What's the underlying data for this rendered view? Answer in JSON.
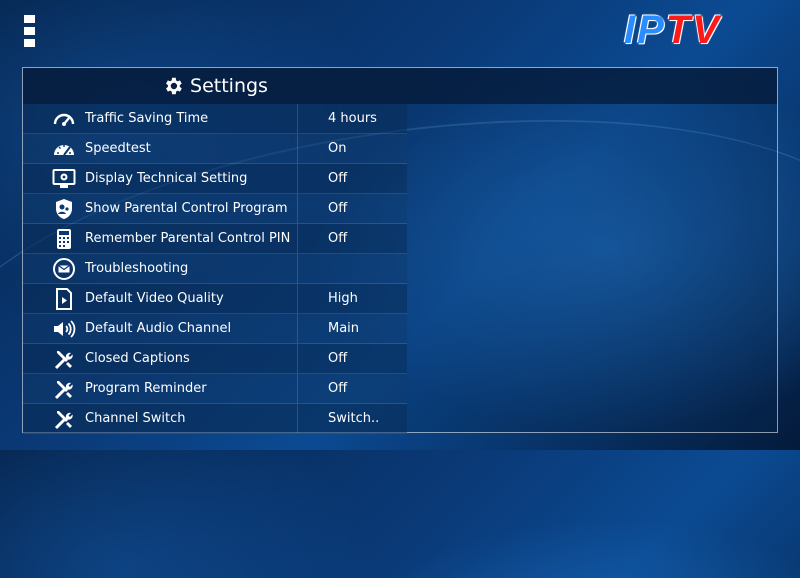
{
  "logo": {
    "part1": "IP",
    "part2": "TV"
  },
  "header": {
    "title": "Settings"
  },
  "settings": [
    {
      "label": "Traffic Saving Time",
      "value": "4 hours",
      "icon": "gauge-icon"
    },
    {
      "label": "Speedtest",
      "value": "On",
      "icon": "speedometer-icon"
    },
    {
      "label": "Display Technical Setting",
      "value": "Off",
      "icon": "monitor-gear-icon"
    },
    {
      "label": "Show Parental Control Program",
      "value": "Off",
      "icon": "parental-shield-icon"
    },
    {
      "label": "Remember Parental Control PIN",
      "value": "Off",
      "icon": "pin-keypad-icon"
    },
    {
      "label": "Troubleshooting",
      "value": "",
      "icon": "envelope-icon"
    },
    {
      "label": "Default Video Quality",
      "value": "High",
      "icon": "video-file-icon"
    },
    {
      "label": "Default Audio Channel",
      "value": "Main",
      "icon": "speaker-icon"
    },
    {
      "label": "Closed Captions",
      "value": "Off",
      "icon": "tools-icon"
    },
    {
      "label": "Program Reminder",
      "value": "Off",
      "icon": "tools-icon"
    },
    {
      "label": "Channel Switch",
      "value": "Switch..",
      "icon": "tools-icon"
    }
  ]
}
